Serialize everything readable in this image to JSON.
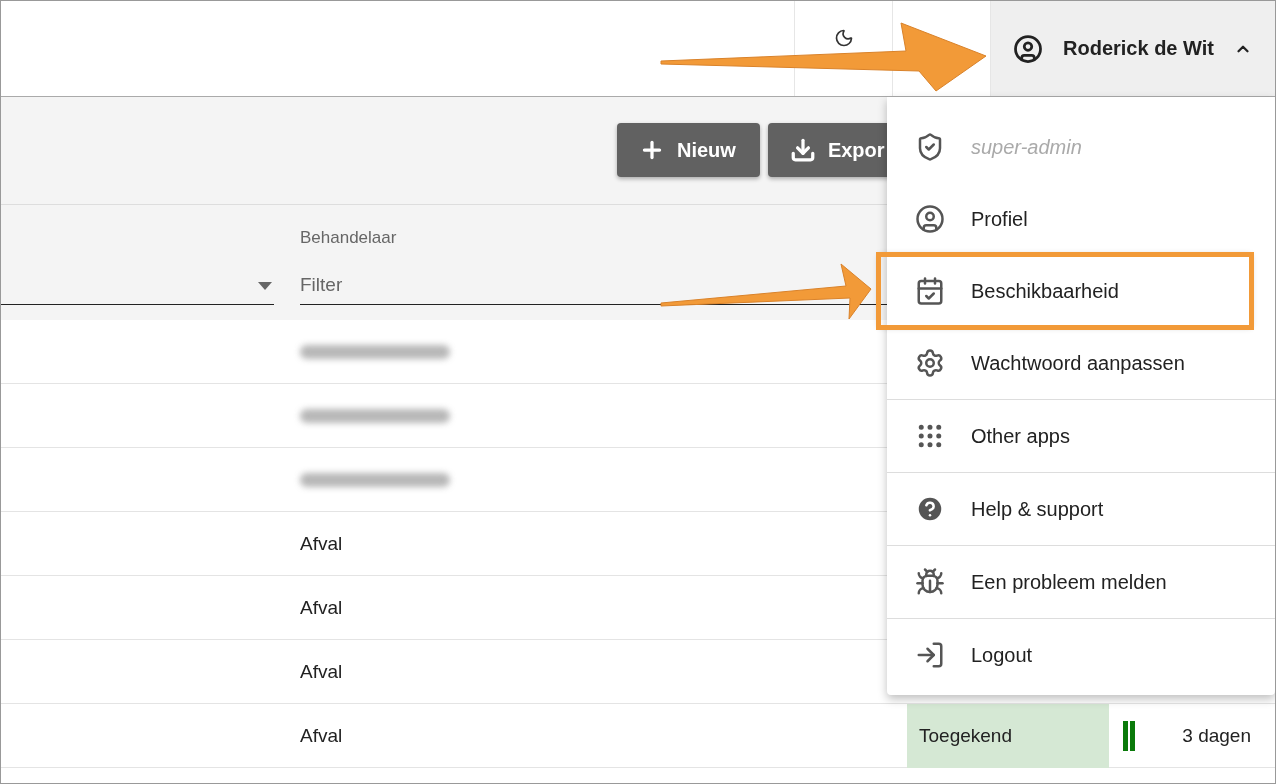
{
  "header": {
    "user": {
      "name": "Roderick de Wit",
      "expanded": true,
      "annotated": true
    }
  },
  "toolbar": {
    "buttons": [
      {
        "kind": "add",
        "label": "Nieuw"
      },
      {
        "kind": "export",
        "label": "Expor"
      }
    ]
  },
  "filters": {
    "behandelaar": {
      "label": "Behandelaar",
      "placeholder": "Filter"
    }
  },
  "rows": [
    {
      "kind": "blurred"
    },
    {
      "kind": "blurred"
    },
    {
      "kind": "blurred"
    },
    {
      "kind": "text",
      "handler": "Afval"
    },
    {
      "kind": "text",
      "handler": "Afval"
    },
    {
      "kind": "text",
      "handler": "Afval"
    },
    {
      "kind": "text",
      "handler": "Afval",
      "status": "Toegekend",
      "duration": "3 dagen"
    }
  ],
  "user_menu": {
    "groups": [
      [
        {
          "kind": "role",
          "label": "super-admin",
          "disabled": true,
          "highlighted": false
        },
        {
          "kind": "profile",
          "label": "Profiel",
          "disabled": false,
          "highlighted": false
        },
        {
          "kind": "availability",
          "label": "Beschikbaarheid",
          "disabled": false,
          "highlighted": true
        },
        {
          "kind": "password",
          "label": "Wachtwoord aanpassen",
          "disabled": false,
          "highlighted": false
        }
      ],
      [
        {
          "kind": "apps",
          "label": "Other apps",
          "disabled": false,
          "highlighted": false
        }
      ],
      [
        {
          "kind": "help",
          "label": "Help & support",
          "disabled": false,
          "highlighted": false
        }
      ],
      [
        {
          "kind": "bug",
          "label": "Een probleem melden",
          "disabled": false,
          "highlighted": false
        }
      ],
      [
        {
          "kind": "logout",
          "label": "Logout",
          "disabled": false,
          "highlighted": false
        }
      ]
    ]
  }
}
